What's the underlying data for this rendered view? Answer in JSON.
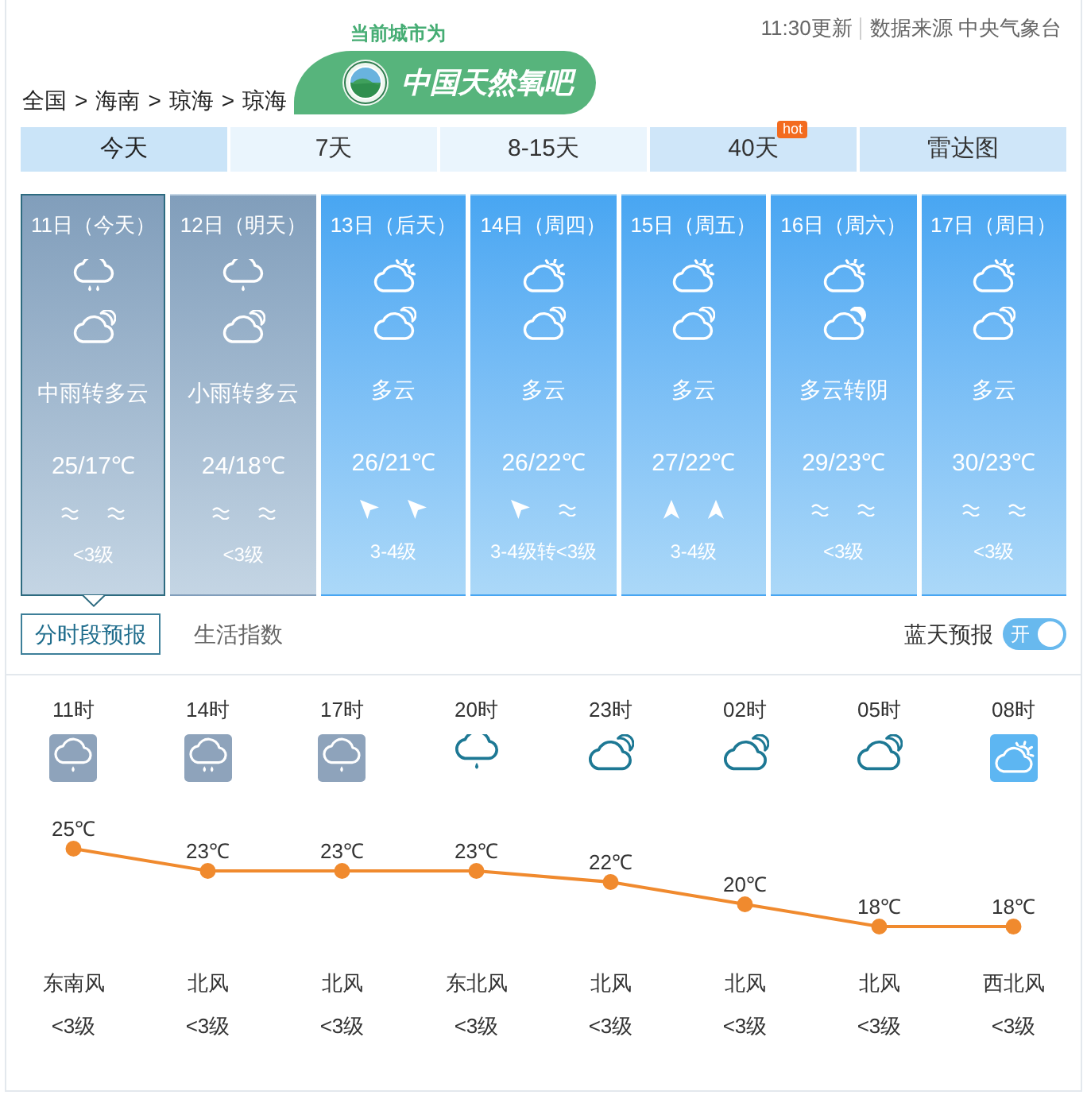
{
  "header": {
    "update_time": "11:30更新",
    "source": "数据来源 中央气象台"
  },
  "breadcrumb": {
    "items": [
      "全国",
      "海南",
      "琼海"
    ],
    "separator": ">",
    "current": "琼海"
  },
  "badge": {
    "caption": "当前城市为",
    "title": "中国天然氧吧"
  },
  "tabs": [
    {
      "label": "今天",
      "selected": true,
      "highlighted": false
    },
    {
      "label": "7天",
      "selected": false,
      "highlighted": false
    },
    {
      "label": "8-15天",
      "selected": false,
      "highlighted": false
    },
    {
      "label": "40天",
      "selected": false,
      "highlighted": true,
      "badge": "hot"
    },
    {
      "label": "雷达图",
      "selected": false,
      "highlighted": true
    }
  ],
  "days": [
    {
      "date": "11日（今天）",
      "selected": true,
      "kind": "rainy",
      "day_icon": {
        "kind": "moderate-rain"
      },
      "night_icon": {
        "kind": "partly-cloudy"
      },
      "description": "中雨转多云",
      "temperature": "25/17℃",
      "wind_icons": [
        {
          "kind": "calm"
        },
        {
          "kind": "calm"
        }
      ],
      "wind_level": "<3级"
    },
    {
      "date": "12日（明天）",
      "selected": false,
      "kind": "rainy",
      "day_icon": {
        "kind": "light-rain"
      },
      "night_icon": {
        "kind": "partly-cloudy"
      },
      "description": "小雨转多云",
      "temperature": "24/18℃",
      "wind_icons": [
        {
          "kind": "calm"
        },
        {
          "kind": "calm"
        }
      ],
      "wind_level": "<3级"
    },
    {
      "date": "13日（后天）",
      "selected": false,
      "kind": "cloudy",
      "day_icon": {
        "kind": "partly-cloudy"
      },
      "night_icon": {
        "kind": "partly-cloudy"
      },
      "description": "多云",
      "temperature": "26/21℃",
      "wind_icons": [
        {
          "kind": "up-left"
        },
        {
          "kind": "up-left"
        }
      ],
      "wind_level": "3-4级"
    },
    {
      "date": "14日（周四）",
      "selected": false,
      "kind": "cloudy",
      "day_icon": {
        "kind": "partly-cloudy"
      },
      "night_icon": {
        "kind": "partly-cloudy"
      },
      "description": "多云",
      "temperature": "26/22℃",
      "wind_icons": [
        {
          "kind": "up-left"
        },
        {
          "kind": "calm"
        }
      ],
      "wind_level": "3-4级转<3级"
    },
    {
      "date": "15日（周五）",
      "selected": false,
      "kind": "cloudy",
      "day_icon": {
        "kind": "partly-cloudy"
      },
      "night_icon": {
        "kind": "partly-cloudy"
      },
      "description": "多云",
      "temperature": "27/22℃",
      "wind_icons": [
        {
          "kind": "up"
        },
        {
          "kind": "up"
        }
      ],
      "wind_level": "3-4级"
    },
    {
      "date": "16日（周六）",
      "selected": false,
      "kind": "cloudy",
      "day_icon": {
        "kind": "partly-cloudy"
      },
      "night_icon": {
        "kind": "overcast"
      },
      "description": "多云转阴",
      "temperature": "29/23℃",
      "wind_icons": [
        {
          "kind": "calm"
        },
        {
          "kind": "calm"
        }
      ],
      "wind_level": "<3级"
    },
    {
      "date": "17日（周日）",
      "selected": false,
      "kind": "cloudy",
      "day_icon": {
        "kind": "partly-cloudy"
      },
      "night_icon": {
        "kind": "partly-cloudy"
      },
      "description": "多云",
      "temperature": "30/23℃",
      "wind_icons": [
        {
          "kind": "calm"
        },
        {
          "kind": "calm"
        }
      ],
      "wind_level": "<3级"
    }
  ],
  "view_tabs": [
    {
      "label": "分时段预报",
      "selected": true
    },
    {
      "label": "生活指数",
      "selected": false
    }
  ],
  "blue_sky_forecast": {
    "label": "蓝天预报",
    "on": true,
    "state_text": "开"
  },
  "hourly": [
    {
      "time": "11时",
      "icon": {
        "kind": "light-rain"
      },
      "daytime": true,
      "wind_direction": "东南风",
      "wind_level": "<3级"
    },
    {
      "time": "14时",
      "icon": {
        "kind": "moderate-rain"
      },
      "daytime": true,
      "wind_direction": "北风",
      "wind_level": "<3级"
    },
    {
      "time": "17时",
      "icon": {
        "kind": "light-rain"
      },
      "daytime": true,
      "wind_direction": "北风",
      "wind_level": "<3级"
    },
    {
      "time": "20时",
      "icon": {
        "kind": "light-rain"
      },
      "daytime": false,
      "wind_direction": "东北风",
      "wind_level": "<3级"
    },
    {
      "time": "23时",
      "icon": {
        "kind": "partly-cloudy"
      },
      "daytime": false,
      "wind_direction": "北风",
      "wind_level": "<3级"
    },
    {
      "time": "02时",
      "icon": {
        "kind": "partly-cloudy"
      },
      "daytime": false,
      "wind_direction": "北风",
      "wind_level": "<3级"
    },
    {
      "time": "05时",
      "icon": {
        "kind": "partly-cloudy"
      },
      "daytime": false,
      "wind_direction": "北风",
      "wind_level": "<3级"
    },
    {
      "time": "08时",
      "icon": {
        "kind": "partly-cloudy"
      },
      "daytime": true,
      "wind_direction": "西北风",
      "wind_level": "<3级"
    }
  ],
  "temperature_chart": {
    "chart_data": {
      "type": "line",
      "series": [
        {
          "color": "#f08a2e",
          "marker": "circle",
          "values": [
            25,
            23,
            23,
            23,
            22,
            20,
            18,
            18
          ],
          "value_labels": [
            "25℃",
            "23℃",
            "23℃",
            "23℃",
            "22℃",
            "20℃",
            "18℃",
            "18℃"
          ]
        }
      ],
      "data_labels": true
    }
  }
}
